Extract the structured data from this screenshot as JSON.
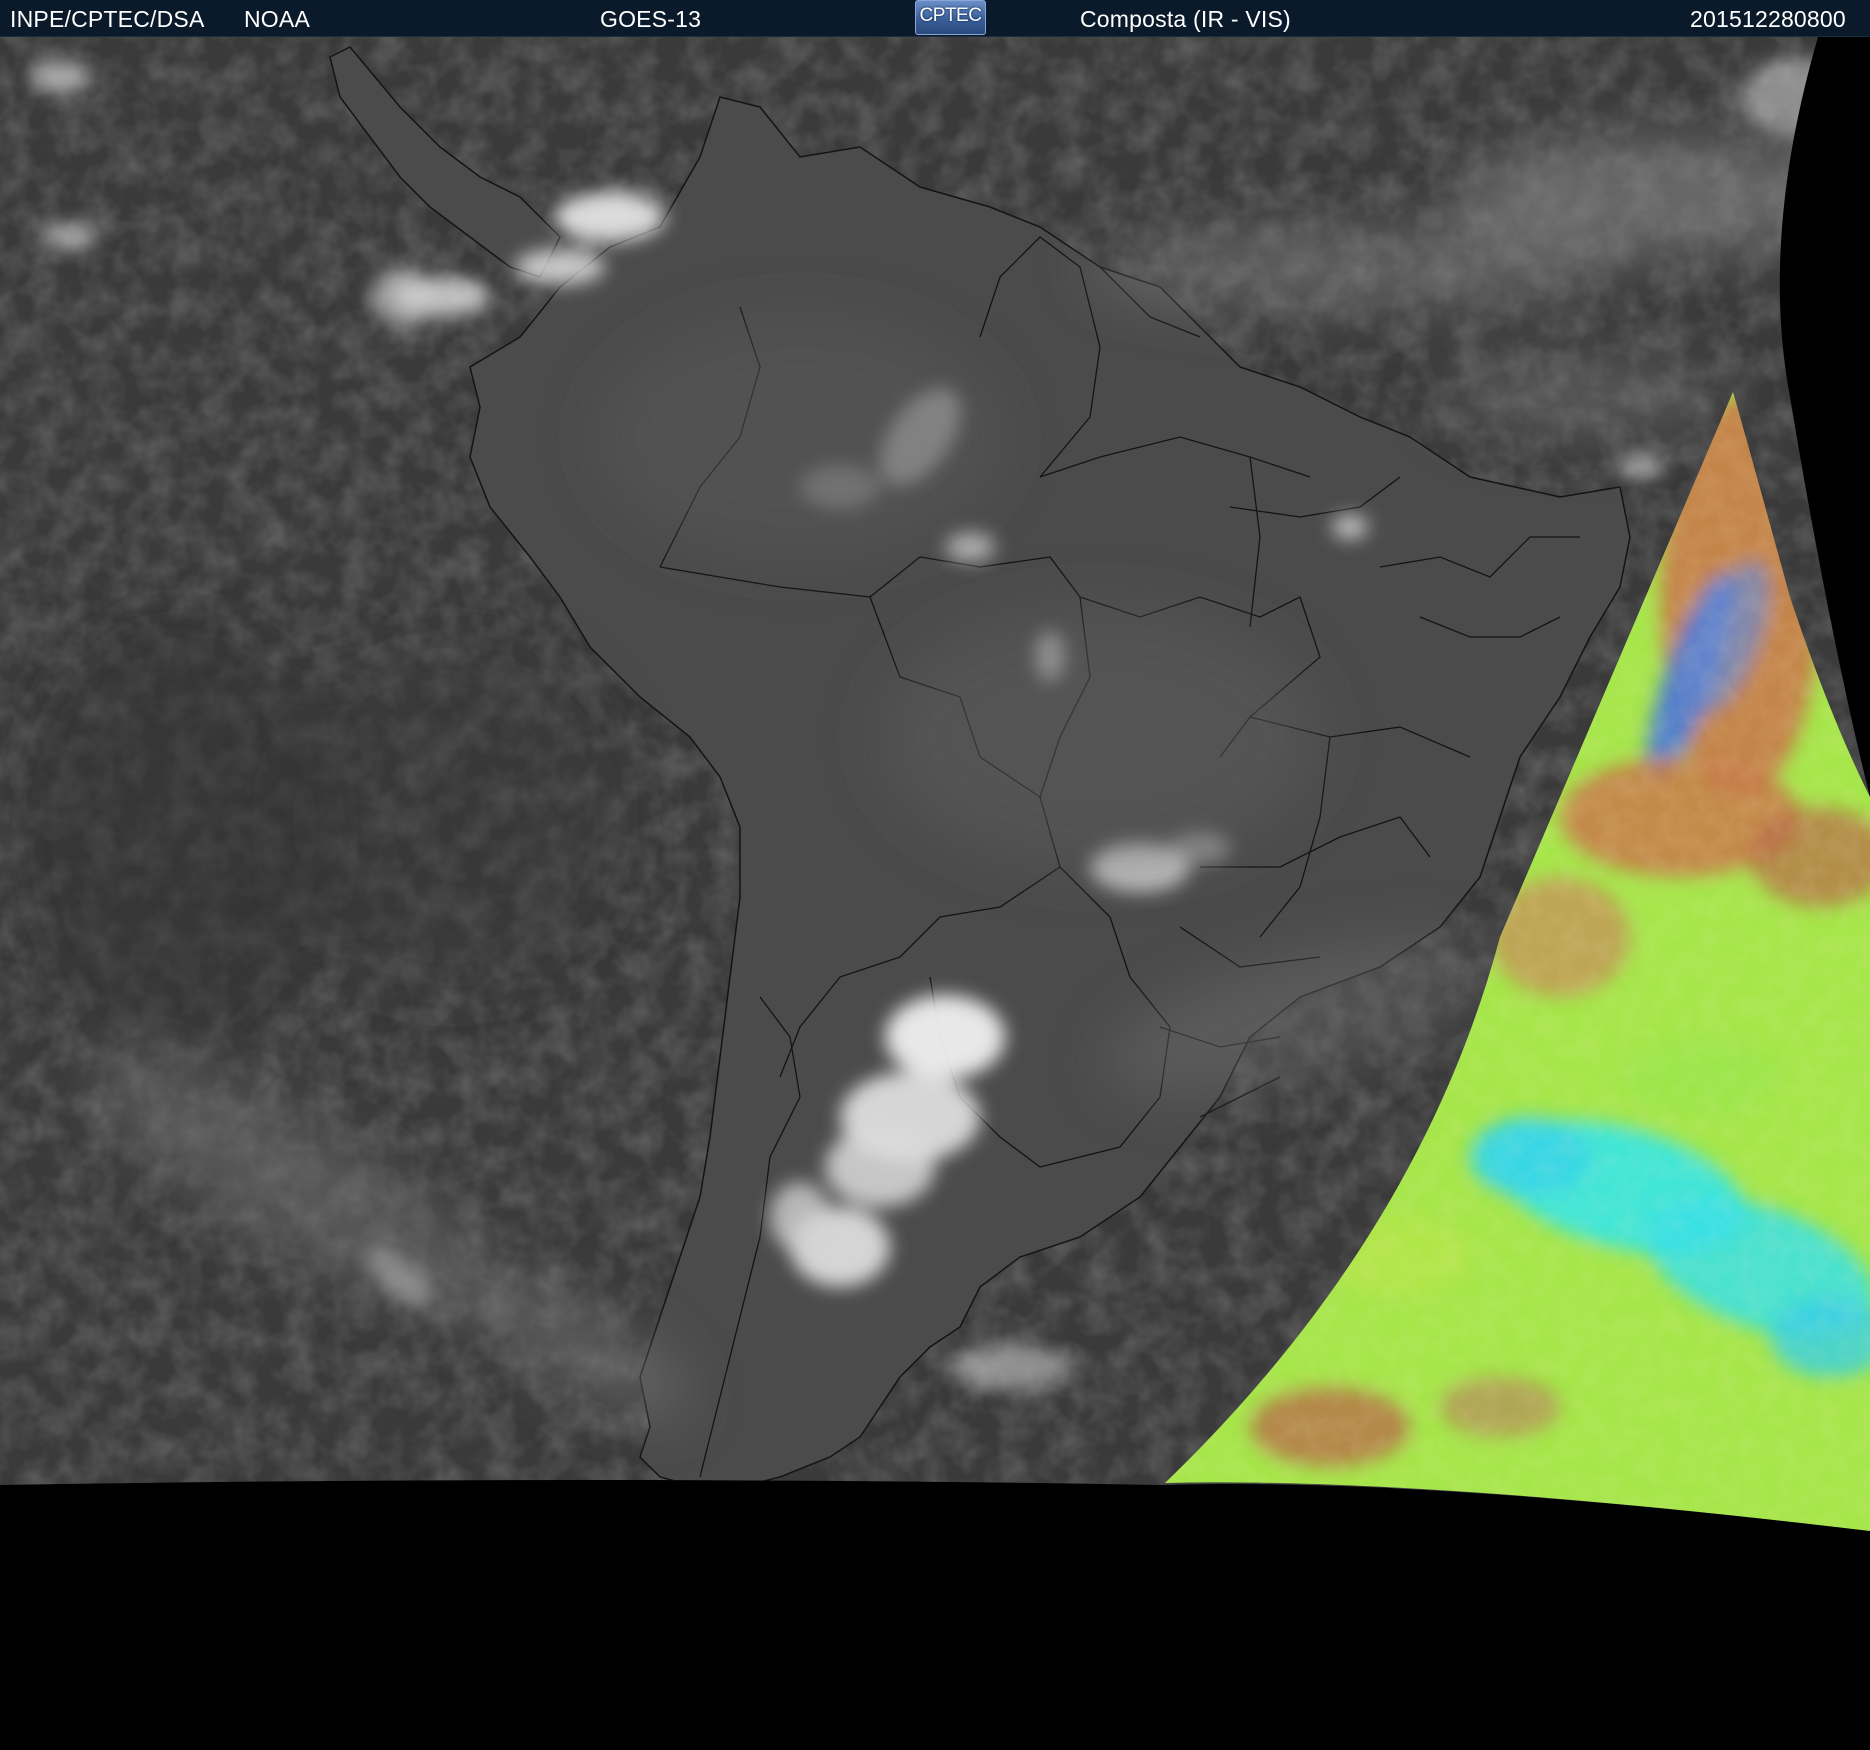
{
  "header": {
    "agency": "INPE/CPTEC/DSA",
    "source": "NOAA",
    "satellite": "GOES-13",
    "logo_text": "CPTEC",
    "product": "Composta (IR - VIS)",
    "timestamp": "201512280800"
  },
  "map": {
    "region": "South America",
    "layers": [
      "ir-grayscale-imagery",
      "vis-false-color-imagery",
      "political-boundaries"
    ],
    "colors": {
      "ocean_ir": "#3a3a3a",
      "land_ir": "#4a4a4a",
      "cloud_bright": "#e6e6e6",
      "background": "#000000",
      "boundary_lines": "#000000",
      "vis_green": "#a6e64a",
      "vis_cyan": "#39e6e6",
      "vis_orange": "#c87a4a",
      "vis_blue": "#4a7ad8"
    }
  }
}
